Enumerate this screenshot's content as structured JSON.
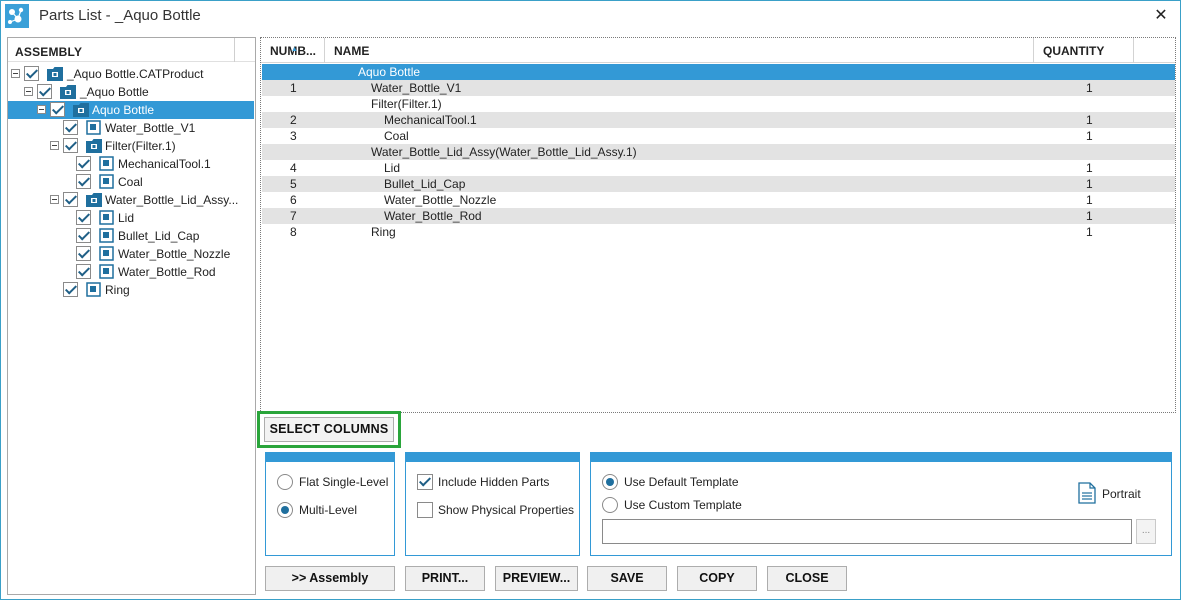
{
  "window": {
    "title": "Parts List - _Aquo Bottle",
    "close_label": "✕"
  },
  "assembly_tree": {
    "header": "ASSEMBLY",
    "nodes": [
      {
        "label": "_Aquo Bottle.CATProduct"
      },
      {
        "label": "_Aquo Bottle"
      },
      {
        "label": "Aquo Bottle"
      },
      {
        "label": "Water_Bottle_V1"
      },
      {
        "label": "Filter(Filter.1)"
      },
      {
        "label": "MechanicalTool.1"
      },
      {
        "label": "Coal"
      },
      {
        "label": "Water_Bottle_Lid_Assy..."
      },
      {
        "label": "Lid"
      },
      {
        "label": "Bullet_Lid_Cap"
      },
      {
        "label": "Water_Bottle_Nozzle"
      },
      {
        "label": "Water_Bottle_Rod"
      },
      {
        "label": "Ring"
      }
    ]
  },
  "parts_grid": {
    "columns": {
      "number": "NUMB...",
      "name": "NAME",
      "quantity": "QUANTITY"
    },
    "rows": [
      {
        "number": "",
        "name": "Aquo Bottle",
        "quantity": ""
      },
      {
        "number": "1",
        "name": "Water_Bottle_V1",
        "quantity": "1"
      },
      {
        "number": "",
        "name": "Filter(Filter.1)",
        "quantity": ""
      },
      {
        "number": "2",
        "name": "MechanicalTool.1",
        "quantity": "1"
      },
      {
        "number": "3",
        "name": "Coal",
        "quantity": "1"
      },
      {
        "number": "",
        "name": "Water_Bottle_Lid_Assy(Water_Bottle_Lid_Assy.1)",
        "quantity": ""
      },
      {
        "number": "4",
        "name": "Lid",
        "quantity": "1"
      },
      {
        "number": "5",
        "name": "Bullet_Lid_Cap",
        "quantity": "1"
      },
      {
        "number": "6",
        "name": "Water_Bottle_Nozzle",
        "quantity": "1"
      },
      {
        "number": "7",
        "name": "Water_Bottle_Rod",
        "quantity": "1"
      },
      {
        "number": "8",
        "name": "Ring",
        "quantity": "1"
      }
    ]
  },
  "select_columns_label": "SELECT COLUMNS",
  "structure_options": {
    "flat": "Flat Single-Level",
    "multi": "Multi-Level",
    "selected": "multi"
  },
  "display_options": {
    "include_hidden": "Include Hidden Parts",
    "include_hidden_checked": true,
    "show_physical": "Show Physical Properties",
    "show_physical_checked": false
  },
  "template_options": {
    "default": "Use Default Template",
    "custom": "Use Custom Template",
    "selected": "default",
    "custom_path": "",
    "browse_label": "...",
    "orientation_label": "Portrait"
  },
  "buttons": {
    "assembly": ">> Assembly",
    "print": "PRINT...",
    "preview": "PREVIEW...",
    "save": "SAVE",
    "copy": "COPY",
    "close": "CLOSE"
  },
  "colors": {
    "accent": "#3399d6",
    "highlight_border": "#2aa53b",
    "alt_row": "#e3e3e3"
  }
}
